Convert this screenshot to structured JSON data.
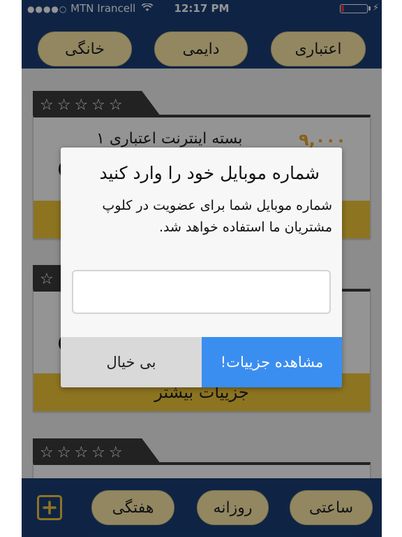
{
  "status_bar": {
    "carrier": "MTN Irancell",
    "signal_dots": "●●●●○",
    "wifi_icon": "wifi-icon",
    "time": "12:17 PM",
    "battery_level": 0.1,
    "battery_color": "#e0383e",
    "charging_icon": "⚡"
  },
  "header": {
    "tabs": [
      {
        "label": "اعتباری"
      },
      {
        "label": "دایمی"
      },
      {
        "label": "خانگی"
      }
    ]
  },
  "cards": [
    {
      "stars": "☆☆☆☆☆",
      "price": "۹,۰۰۰",
      "title": "بسته اینترنت اعتباری ۱",
      "cta": ""
    },
    {
      "stars": "☆",
      "price": "",
      "title": "",
      "cta": "جزییات بیشتر"
    },
    {
      "stars": "☆☆☆☆☆",
      "price": "",
      "title": "",
      "cta": ""
    }
  ],
  "footer": {
    "tabs": [
      {
        "label": "ساعتی"
      },
      {
        "label": "روزانه"
      },
      {
        "label": "هفتگی"
      }
    ],
    "plus_icon": "plus-square-icon"
  },
  "dialog": {
    "title": "شماره موبایل خود را وارد کنید",
    "message": "شماره موبایل شما برای عضویت در کلوپ مشتریان ما استفاده خواهد شد.",
    "input_value": "",
    "dismiss_label": "بی خیال",
    "confirm_label": "مشاهده جزییات!"
  },
  "colors": {
    "nav_bar": "#1a3f78",
    "pill": "#fbe9a8",
    "accent_yellow": "#f3c93a",
    "dialog_primary": "#3a8ef0",
    "dialog_secondary": "#d9d9d9"
  }
}
